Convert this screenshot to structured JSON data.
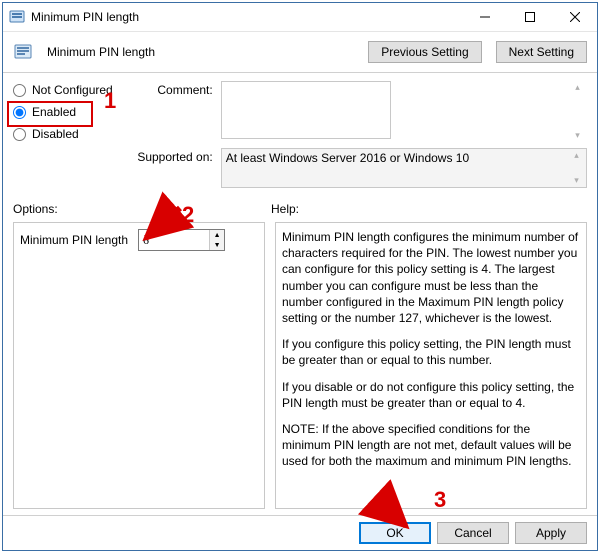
{
  "titlebar": {
    "title": "Minimum PIN length"
  },
  "header": {
    "title": "Minimum PIN length",
    "buttons": {
      "prev": "Previous Setting",
      "next": "Next Setting"
    }
  },
  "state": {
    "not_configured": "Not Configured",
    "enabled": "Enabled",
    "disabled": "Disabled"
  },
  "comment": {
    "label": "Comment:",
    "value": ""
  },
  "supported": {
    "label": "Supported on:",
    "value": "At least Windows Server 2016 or Windows 10"
  },
  "options": {
    "heading": "Options:",
    "pin_label": "Minimum PIN length",
    "pin_value": "6"
  },
  "help": {
    "heading": "Help:",
    "p1": "Minimum PIN length configures the minimum number of characters required for the PIN.  The lowest number you can configure for this policy setting is 4.  The largest number you can configure must be less than the number configured in the Maximum PIN length policy setting or the number 127, whichever is the lowest.",
    "p2": "If you configure this policy setting, the PIN length must be greater than or equal to this number.",
    "p3": "If you disable or do not configure this policy setting, the PIN length must be greater than or equal to 4.",
    "p4": "NOTE: If the above specified conditions for the minimum PIN length are not met, default values will be used for both the maximum and minimum PIN lengths."
  },
  "buttons": {
    "ok": "OK",
    "cancel": "Cancel",
    "apply": "Apply"
  },
  "annotations": {
    "n1": "1",
    "n2": "2",
    "n3": "3"
  }
}
